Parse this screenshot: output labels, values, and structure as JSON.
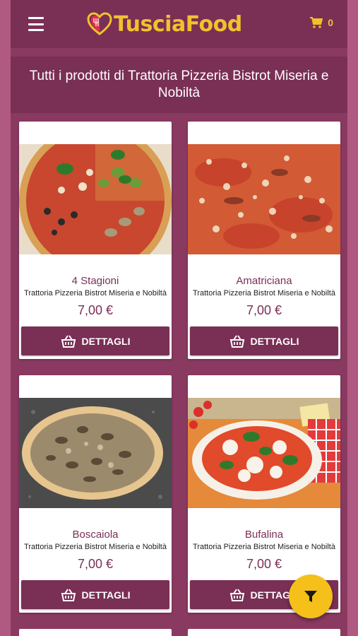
{
  "header": {
    "logo_text": "TusciaFood",
    "cart_count": "0",
    "menu_icon": "hamburger-menu-icon",
    "cart_icon": "shopping-cart-icon"
  },
  "page": {
    "title": "Tutti i prodotti di Trattoria Pizzeria Bistrot Miseria e Nobiltà"
  },
  "colors": {
    "brand": "#7a2f55",
    "accent": "#f2c12e",
    "background": "#b05a82"
  },
  "products": [
    {
      "name": "4 Stagioni",
      "restaurant": "Trattoria Pizzeria Bistrot Miseria e Nobiltà",
      "price": "7,00 €",
      "button": "DETTAGLI"
    },
    {
      "name": "Amatriciana",
      "restaurant": "Trattoria Pizzeria Bistrot Miseria e Nobiltà",
      "price": "7,00 €",
      "button": "DETTAGLI"
    },
    {
      "name": "Boscaiola",
      "restaurant": "Trattoria Pizzeria Bistrot Miseria e Nobiltà",
      "price": "7,00 €",
      "button": "DETTAGLI"
    },
    {
      "name": "Bufalina",
      "restaurant": "Trattoria Pizzeria Bistrot Miseria e Nobiltà",
      "price": "7,00 €",
      "button": "DETTAGLI"
    }
  ],
  "fab": {
    "icon": "filter-icon"
  }
}
